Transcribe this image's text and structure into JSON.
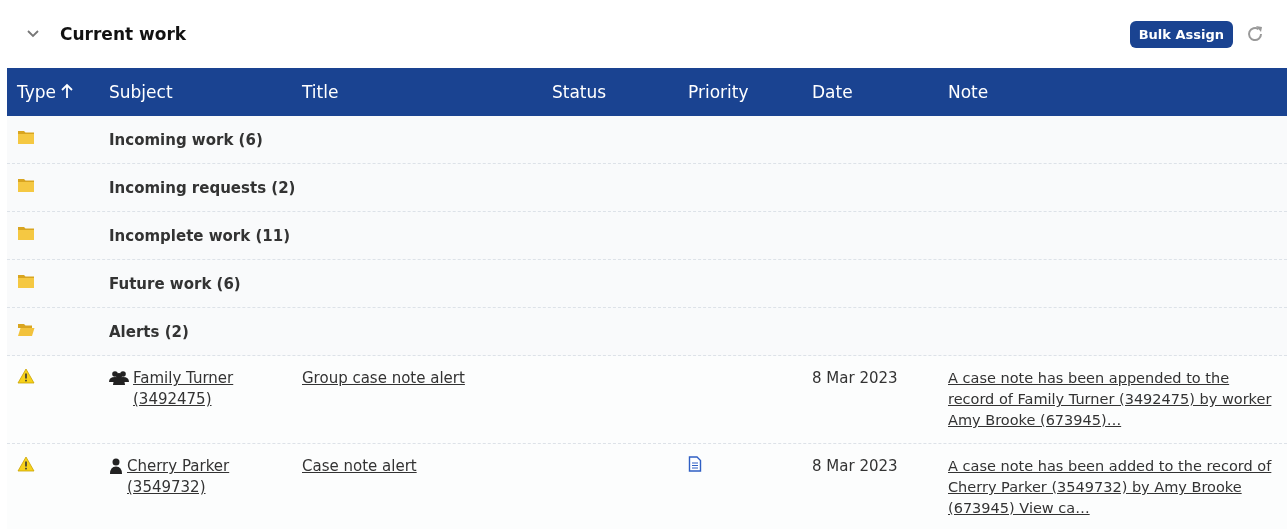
{
  "section": {
    "title": "Current work",
    "expanded": true,
    "bulk_button": "Bulk Assign"
  },
  "table": {
    "columns": [
      {
        "label": "Type",
        "sorted": true
      },
      {
        "label": "Subject",
        "sorted": false
      },
      {
        "label": "Title",
        "sorted": false
      },
      {
        "label": "Status",
        "sorted": false
      },
      {
        "label": "Priority",
        "sorted": false
      },
      {
        "label": "Date",
        "sorted": false
      },
      {
        "label": "Note",
        "sorted": false
      }
    ],
    "rows": [
      {
        "kind": "group",
        "label": "Incoming work (6)",
        "expanded": false
      },
      {
        "kind": "group",
        "label": "Incoming requests (2)",
        "expanded": false
      },
      {
        "kind": "group",
        "label": "Incomplete work (11)",
        "expanded": false
      },
      {
        "kind": "group",
        "label": "Future work (6)",
        "expanded": false
      },
      {
        "kind": "group",
        "label": "Alerts (2)",
        "expanded": true
      },
      {
        "kind": "alert",
        "subject": {
          "kind": "group",
          "text": "Family Turner (3492475)"
        },
        "title": "Group case note alert",
        "has_document": false,
        "date": "8 Mar 2023",
        "note": "A case note has been appended to the record of Family Turner (3492475) by worker Amy Brooke (673945)…"
      },
      {
        "kind": "alert",
        "subject": {
          "kind": "person",
          "text": "Cherry Parker (3549732)"
        },
        "title": "Case note alert",
        "has_document": true,
        "date": "8 Mar 2023",
        "note": "A case note has been added to the record of Cherry Parker (3549732) by Amy Brooke (673945) View ca…"
      }
    ]
  }
}
